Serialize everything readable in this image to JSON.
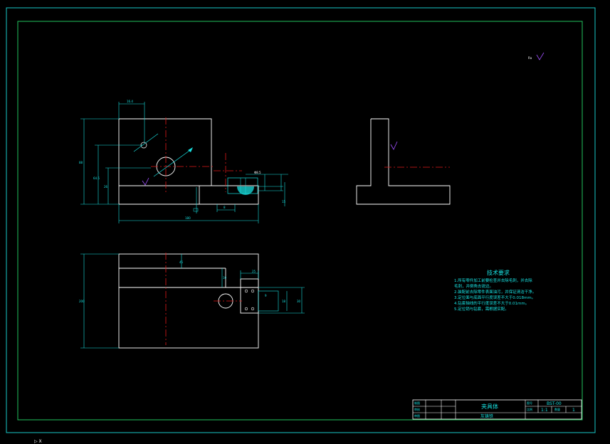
{
  "colors": {
    "background": "#000000",
    "frame": "#22c55e",
    "outer_frame": "#18c8c8",
    "geometry": "#ffffff",
    "centerline": "#e01818",
    "dimension": "#18e0e0",
    "text": "#18e0e0",
    "accent": "#a050ff"
  },
  "title_block": {
    "part_name": "夹具体",
    "material": "灰铸铁",
    "drawing_no_label": "图号",
    "drawing_no": "BST-00",
    "scale_label": "比例",
    "scale": "1:1",
    "quantity_label": "数量",
    "quantity": "1",
    "roles": [
      "制图",
      "审核",
      "审图"
    ]
  },
  "tech_requirements": {
    "heading": "技术要求",
    "items": [
      "1.所有零件加工前要检查并去除毛刺，并去除",
      "  毛刺，并倒角去锐边。",
      "2.装配前去除零件表面油污，并保证清洁干净。",
      "3.定位面与底面平行度误差不大于0.018mm。",
      "4.钻套轴线的平行度误差不大于0.01mm。",
      "5.定位销与钻套，需根据实配。"
    ]
  },
  "dimensions": {
    "top_width": "16.4",
    "height_total": "88",
    "height_mid": "64.5",
    "height_low": "26",
    "base_width": "180",
    "hole_dia": "Φ8.5",
    "small_dim": "8",
    "side_dim": "15",
    "plan_depth": "200",
    "plan_dim_a": "45",
    "plan_dim_b": "10",
    "plan_dim_c": "25",
    "plan_dim_d": "18",
    "plan_dim_e": "30",
    "plan_dim_f": "9"
  },
  "roughness_label": "Ra",
  "command_cursor": "▷ X"
}
